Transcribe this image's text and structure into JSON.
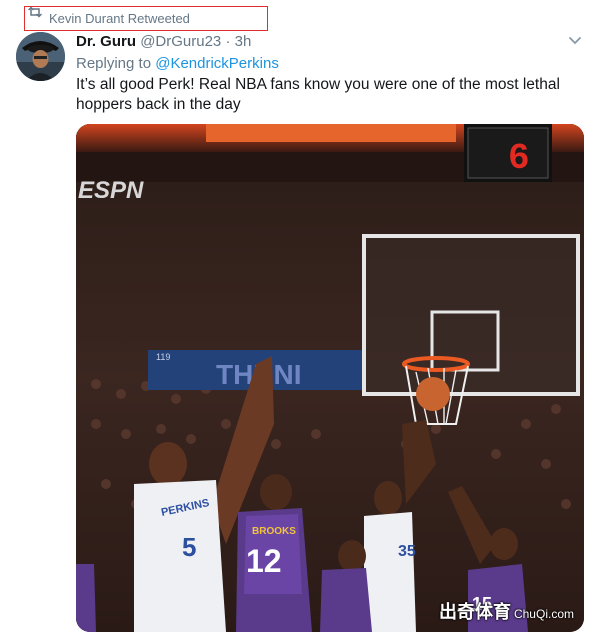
{
  "retweet_banner": {
    "text": "Kevin Durant Retweeted"
  },
  "tweet": {
    "display_name": "Dr. Guru",
    "handle": "@DrGuru23",
    "separator": "·",
    "time": "3h",
    "replying_prefix": "Replying to",
    "replying_to": "@KendrickPerkins",
    "text": "It’s all good Perk! Real NBA fans know you were one of the most lethal hoppers back in the day"
  },
  "media": {
    "scoreboard_value": "6",
    "broadcaster": "ESPN",
    "arena_banner": "THUNI",
    "arena_number": "119",
    "players": [
      {
        "name": "PERKINS",
        "number": "5"
      },
      {
        "name": "BROOKS",
        "number": "12"
      },
      {
        "name": "",
        "number": "35"
      },
      {
        "name": "",
        "number": "15"
      }
    ]
  },
  "watermark": {
    "cn": "出奇体育",
    "en": "ChuQi.com"
  },
  "icons": [
    "retweet-icon",
    "chevron-down-icon",
    "avatar"
  ],
  "colors": {
    "link": "#1b95e0",
    "muted": "#657786",
    "annotation_box": "#e0302e",
    "text": "#14171a"
  }
}
